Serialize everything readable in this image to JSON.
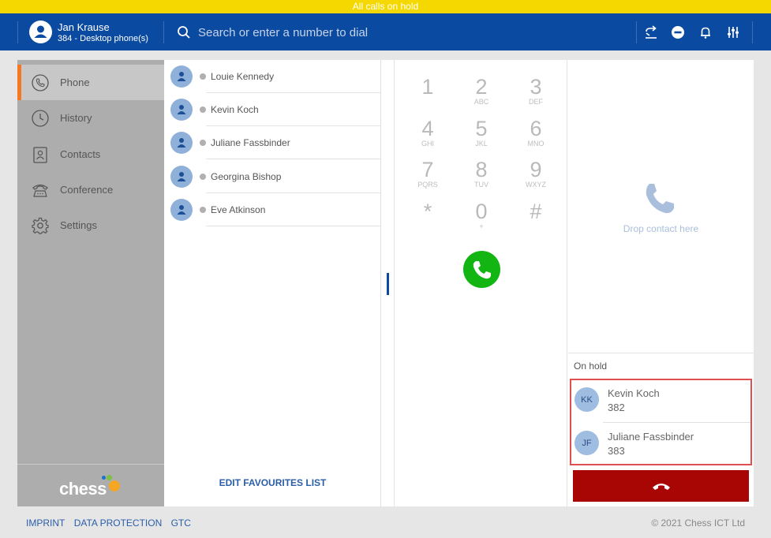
{
  "banner": {
    "text": "All calls on hold",
    "color": "#f5d800"
  },
  "header": {
    "bg_color": "#0a4aa0",
    "user_name": "Jan Krause",
    "user_sub": "384 - Desktop phone(s)",
    "search_placeholder": "Search or enter a number to dial",
    "icons": [
      "call-forward-icon",
      "do-not-disturb-icon",
      "bell-icon",
      "sliders-icon"
    ]
  },
  "sidebar": {
    "items": [
      {
        "label": "Phone",
        "icon": "phone-icon",
        "active": true
      },
      {
        "label": "History",
        "icon": "clock-icon"
      },
      {
        "label": "Contacts",
        "icon": "contact-card-icon"
      },
      {
        "label": "Conference",
        "icon": "conference-phone-icon"
      },
      {
        "label": "Settings",
        "icon": "gear-icon"
      }
    ],
    "logo_text": "chess",
    "accent_color": "#f47920"
  },
  "favourites": {
    "items": [
      {
        "name": "Louie Kennedy"
      },
      {
        "name": "Kevin Koch"
      },
      {
        "name": "Juliane Fassbinder"
      },
      {
        "name": "Georgina Bishop"
      },
      {
        "name": "Eve Atkinson"
      }
    ],
    "edit_label": "EDIT FAVOURITES LIST"
  },
  "dialpad": {
    "keys": [
      {
        "digit": "1",
        "letters": ""
      },
      {
        "digit": "2",
        "letters": "ABC"
      },
      {
        "digit": "3",
        "letters": "DEF"
      },
      {
        "digit": "4",
        "letters": "GHI"
      },
      {
        "digit": "5",
        "letters": "JKL"
      },
      {
        "digit": "6",
        "letters": "MNO"
      },
      {
        "digit": "7",
        "letters": "PQRS"
      },
      {
        "digit": "8",
        "letters": "TUV"
      },
      {
        "digit": "9",
        "letters": "WXYZ"
      },
      {
        "digit": "*",
        "letters": ""
      },
      {
        "digit": "0",
        "letters": "+"
      },
      {
        "digit": "#",
        "letters": ""
      }
    ],
    "call_color": "#12b512"
  },
  "right_panel": {
    "drop_text": "Drop contact here",
    "on_hold_label": "On hold",
    "on_hold": [
      {
        "initials": "KK",
        "name": "Kevin Koch",
        "number": "382"
      },
      {
        "initials": "JF",
        "name": "Juliane Fassbinder",
        "number": "383"
      }
    ],
    "hangup_color": "#a80505"
  },
  "footer": {
    "links": [
      "IMPRINT",
      "DATA PROTECTION",
      "GTC"
    ],
    "copyright": "© 2021 Chess ICT Ltd"
  }
}
